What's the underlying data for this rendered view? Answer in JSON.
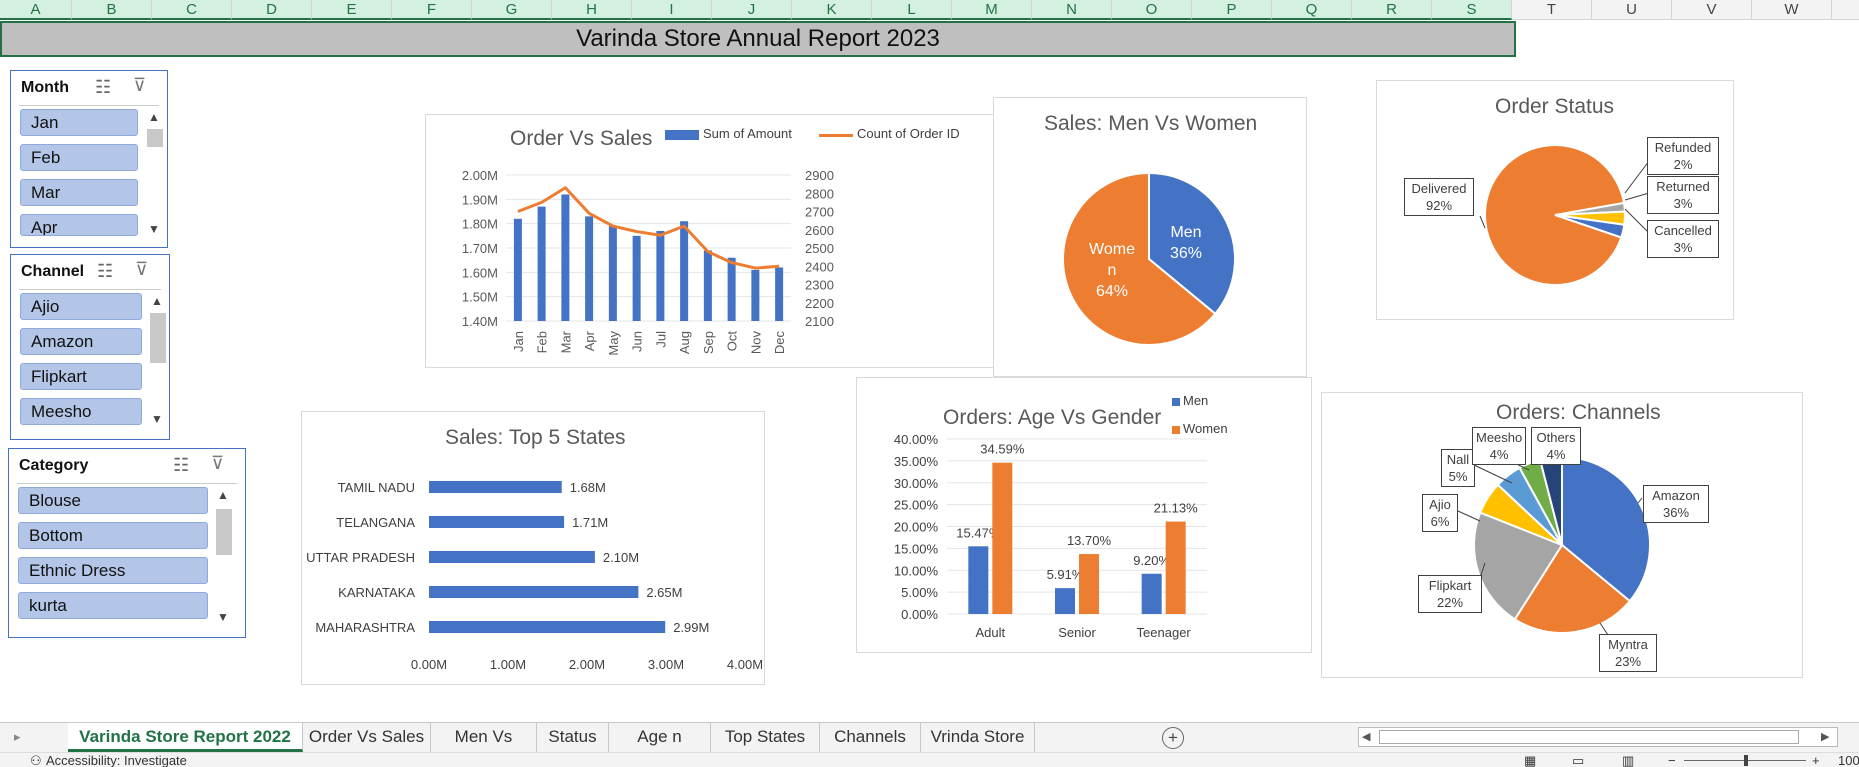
{
  "columns": [
    "A",
    "B",
    "C",
    "D",
    "E",
    "F",
    "G",
    "H",
    "I",
    "J",
    "K",
    "L",
    "M",
    "N",
    "O",
    "P",
    "Q",
    "R",
    "S",
    "T",
    "U",
    "V",
    "W"
  ],
  "report_title": "Varinda Store Annual Report 2023",
  "slicers": {
    "month": {
      "title": "Month",
      "items": [
        "Jan",
        "Feb",
        "Mar",
        "Apr"
      ]
    },
    "channel": {
      "title": "Channel",
      "items": [
        "Ajio",
        "Amazon",
        "Flipkart",
        "Meesho"
      ]
    },
    "category": {
      "title": "Category",
      "items": [
        "Blouse",
        "Bottom",
        "Ethnic Dress",
        "kurta"
      ]
    }
  },
  "icons": {
    "multiselect": "multi-select-icon",
    "clear_filter": "clear-filter-icon",
    "scroll_up": "scroll-up-icon",
    "scroll_down": "scroll-down-icon",
    "add_sheet": "plus-icon"
  },
  "colors": {
    "blue": "#4472c4",
    "orange": "#ed7d31",
    "gray": "#a5a5a5",
    "yellow": "#ffc000",
    "lightblue": "#5b9bd5",
    "green": "#70ad47",
    "navy": "#264478",
    "excel_green": "#217346"
  },
  "chart_data": [
    {
      "id": "order_vs_sales",
      "type": "bar",
      "title": "Order Vs Sales",
      "categories": [
        "Jan",
        "Feb",
        "Mar",
        "Apr",
        "May",
        "Jun",
        "Jul",
        "Aug",
        "Sep",
        "Oct",
        "Nov",
        "Dec"
      ],
      "series": [
        {
          "name": "Sum of Amount",
          "type": "bar",
          "axis": "left",
          "values": [
            1.82,
            1.87,
            1.92,
            1.83,
            1.79,
            1.75,
            1.77,
            1.81,
            1.69,
            1.66,
            1.61,
            1.62
          ]
        },
        {
          "name": "Count of Order ID",
          "type": "line",
          "axis": "right",
          "values": [
            2700,
            2750,
            2830,
            2690,
            2620,
            2590,
            2570,
            2620,
            2480,
            2420,
            2390,
            2400
          ]
        }
      ],
      "left_ticks": [
        "2.00M",
        "1.90M",
        "1.80M",
        "1.70M",
        "1.60M",
        "1.50M",
        "1.40M"
      ],
      "right_ticks": [
        "2900",
        "2800",
        "2700",
        "2600",
        "2500",
        "2400",
        "2300",
        "2200",
        "2100"
      ],
      "ylim_left": [
        1.4,
        2.0
      ],
      "ylim_right": [
        2100,
        2900
      ],
      "legend": "top"
    },
    {
      "id": "men_vs_women",
      "type": "pie",
      "title": "Sales: Men Vs Women",
      "labels": [
        "Men",
        "Women"
      ],
      "values": [
        36,
        64
      ],
      "data_labels": [
        "Men\n36%",
        "Wome\nn\n64%"
      ]
    },
    {
      "id": "order_status",
      "type": "pie",
      "title": "Order Status",
      "labels": [
        "Delivered",
        "Refunded",
        "Returned",
        "Cancelled"
      ],
      "values": [
        92,
        2,
        3,
        3
      ],
      "callouts": [
        {
          "name": "Delivered",
          "pct": "92%"
        },
        {
          "name": "Refunded",
          "pct": "2%"
        },
        {
          "name": "Returned",
          "pct": "3%"
        },
        {
          "name": "Cancelled",
          "pct": "3%"
        }
      ]
    },
    {
      "id": "top_states",
      "type": "bar",
      "orientation": "horizontal",
      "title": "Sales: Top 5 States",
      "categories": [
        "TAMIL NADU",
        "TELANGANA",
        "UTTAR PRADESH",
        "KARNATAKA",
        "MAHARASHTRA"
      ],
      "values": [
        1.68,
        1.71,
        2.1,
        2.65,
        2.99
      ],
      "value_labels": [
        "1.68M",
        "1.71M",
        "2.10M",
        "2.65M",
        "2.99M"
      ],
      "x_ticks": [
        "0.00M",
        "1.00M",
        "2.00M",
        "3.00M",
        "4.00M"
      ],
      "xlim": [
        0,
        4
      ]
    },
    {
      "id": "age_vs_gender",
      "type": "bar",
      "title": "Orders: Age Vs Gender",
      "categories": [
        "Adult",
        "Senior",
        "Teenager"
      ],
      "series": [
        {
          "name": "Men",
          "values": [
            15.47,
            5.91,
            9.2
          ],
          "labels": [
            "15.47%",
            "5.91%",
            "9.20%"
          ]
        },
        {
          "name": "Women",
          "values": [
            34.59,
            13.7,
            21.13
          ],
          "labels": [
            "34.59%",
            "13.70%",
            "21.13%"
          ]
        }
      ],
      "y_ticks": [
        "40.00%",
        "35.00%",
        "30.00%",
        "25.00%",
        "20.00%",
        "15.00%",
        "10.00%",
        "5.00%",
        "0.00%"
      ],
      "ylim": [
        0,
        40
      ],
      "legend": "top-right"
    },
    {
      "id": "channels",
      "type": "pie",
      "title": "Orders: Channels",
      "labels": [
        "Amazon",
        "Myntra",
        "Flipkart",
        "Ajio",
        "Nalli",
        "Meesho",
        "Others"
      ],
      "values": [
        36,
        23,
        22,
        6,
        5,
        4,
        4
      ],
      "callouts": [
        {
          "name": "Amazon",
          "pct": "36%"
        },
        {
          "name": "Myntra",
          "pct": "23%"
        },
        {
          "name": "Flipkart",
          "pct": "22%"
        },
        {
          "name": "Ajio",
          "pct": "6%"
        },
        {
          "name": "Nall",
          "pct": "5%"
        },
        {
          "name": "Meesho",
          "pct": "4%"
        },
        {
          "name": "Others",
          "pct": "4%"
        }
      ]
    }
  ],
  "sheet_tabs": [
    "Varinda Store Report 2022",
    "Order Vs Sales",
    "Men Vs Women",
    "Status",
    "Age n Gender",
    "Top States",
    "Channels",
    "Vrinda Store"
  ],
  "status": {
    "accessibility": "Accessibility: Investigate",
    "zoom": "100"
  }
}
